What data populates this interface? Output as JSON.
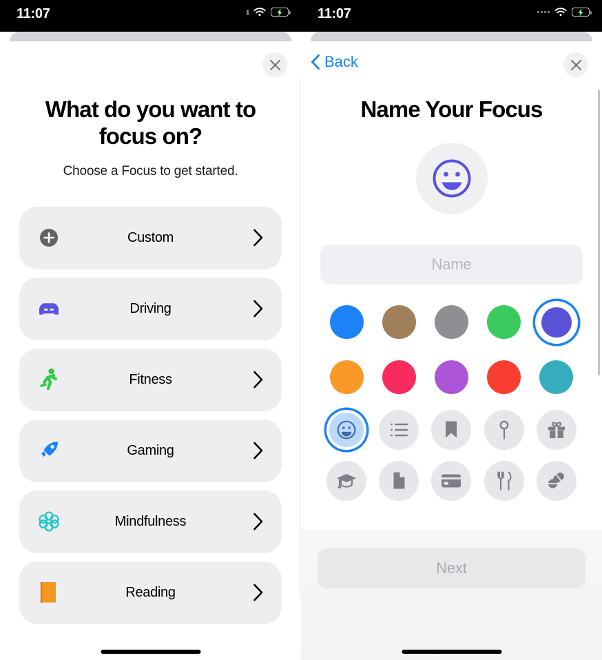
{
  "left_phone": {
    "status": {
      "time": "11:07",
      "battery_level": "78",
      "battery_charging": true,
      "wifi": "wifi-icon"
    },
    "nav": {
      "close_label": "×",
      "close_icon": "close-icon"
    },
    "heading": "What do you want to focus on?",
    "subtitle": "Choose a Focus to get started.",
    "items": [
      {
        "label": "Custom",
        "icon": "plus-circle-icon",
        "color": "#636366"
      },
      {
        "label": "Driving",
        "icon": "car-icon",
        "color": "#5a52e0"
      },
      {
        "label": "Fitness",
        "icon": "running-icon",
        "color": "#34c94a"
      },
      {
        "label": "Gaming",
        "icon": "rocket-icon",
        "color": "#1c82f6"
      },
      {
        "label": "Mindfulness",
        "icon": "flower-icon",
        "color": "#23c7c7"
      },
      {
        "label": "Reading",
        "icon": "book-icon",
        "color": "#f5961e"
      }
    ]
  },
  "right_phone": {
    "status": {
      "time": "11:07",
      "battery_level": "78",
      "battery_charging": true,
      "wifi": "wifi-icon"
    },
    "nav": {
      "back_label": "Back",
      "back_icon": "chevron-left-icon",
      "close_icon": "close-icon"
    },
    "heading": "Name Your Focus",
    "avatar": {
      "icon": "smiley-face-icon",
      "color": "#5a52e0",
      "background": "#f0f0f3"
    },
    "name_input": {
      "value": "",
      "placeholder": "Name"
    },
    "colors": [
      {
        "name": "blue",
        "hex": "#1c82f6",
        "selected": false
      },
      {
        "name": "brown",
        "hex": "#a0805a",
        "selected": false
      },
      {
        "name": "gray",
        "hex": "#8e8e93",
        "selected": false
      },
      {
        "name": "green",
        "hex": "#3aca5e",
        "selected": false
      },
      {
        "name": "indigo",
        "hex": "#5a52d5",
        "selected": true
      },
      {
        "name": "orange",
        "hex": "#f99a28",
        "selected": false
      },
      {
        "name": "pink",
        "hex": "#f92b5e",
        "selected": false
      },
      {
        "name": "purple",
        "hex": "#ad55d8",
        "selected": false
      },
      {
        "name": "red",
        "hex": "#f83e30",
        "selected": false
      },
      {
        "name": "teal",
        "hex": "#36adbf",
        "selected": false
      }
    ],
    "icons": [
      {
        "name": "smiley-face-icon",
        "selected": true
      },
      {
        "name": "list-icon",
        "selected": false
      },
      {
        "name": "bookmark-icon",
        "selected": false
      },
      {
        "name": "pin-icon",
        "selected": false
      },
      {
        "name": "gift-icon",
        "selected": false
      },
      {
        "name": "graduation-cap-icon",
        "selected": false
      },
      {
        "name": "document-icon",
        "selected": false
      },
      {
        "name": "credit-card-icon",
        "selected": false
      },
      {
        "name": "fork-knife-icon",
        "selected": false
      },
      {
        "name": "pills-icon",
        "selected": false
      }
    ],
    "next_label": "Next",
    "accent_color": "#1c82f6"
  }
}
